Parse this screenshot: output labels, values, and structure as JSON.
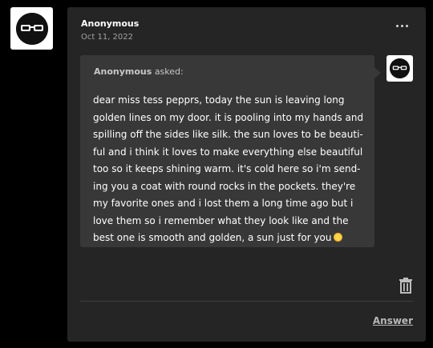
{
  "post": {
    "author": "Anonymous",
    "date": "Oct 11, 2022"
  },
  "ask": {
    "asker": "Anonymous",
    "asked_label": "asked:",
    "message": "dear miss tess pepprs, today the sun is leaving long golden lines on my door. it is pooling into my hands and spilling off the sides like silk. the sun loves to be beauti-ful and i think it loves to make everything else beautiful too so it keeps shining warm. it's cold here so i'm send-ing you a coat with round rocks in the pockets. they're my favorite ones and i lost them a long time ago but i love them so i remember what they look like and the best one is smooth and golden, a sun just for you"
  },
  "actions": {
    "answer_label": "Answer"
  },
  "icons": {
    "more": "more-horizontal-icon",
    "trash": "trash-icon",
    "sun": "sun-emoji-icon"
  }
}
